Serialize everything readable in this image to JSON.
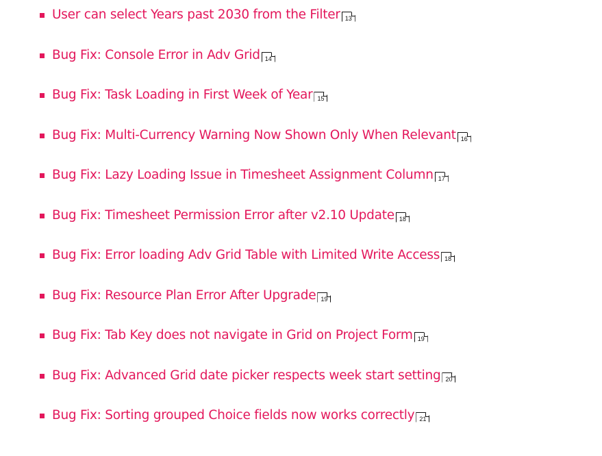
{
  "colors": {
    "link": "#e3175b",
    "bullet": "#e3175b",
    "page_ref": "#111111"
  },
  "bullet_icon": "square-bullet-icon",
  "page_ref_icon": "page-reference-icon",
  "toc": {
    "items": [
      {
        "label": "User can select Years past 2030 from the Filter",
        "page": "13"
      },
      {
        "label": "Bug Fix: Console Error in Adv Grid",
        "page": "14"
      },
      {
        "label": "Bug Fix: Task Loading in First Week of Year",
        "page": "15"
      },
      {
        "label": "Bug Fix: Multi-Currency Warning Now Shown Only When Relevant",
        "page": "16"
      },
      {
        "label": "Bug Fix: Lazy Loading Issue in Timesheet Assignment Column",
        "page": "17"
      },
      {
        "label": "Bug Fix: Timesheet Permission Error after v2.10 Update",
        "page": "18"
      },
      {
        "label": "Bug Fix: Error loading Adv Grid Table with Limited Write Access",
        "page": "18"
      },
      {
        "label": "Bug Fix: Resource Plan Error After Upgrade",
        "page": "19"
      },
      {
        "label": "Bug Fix: Tab Key does not navigate in Grid on Project Form",
        "page": "19"
      },
      {
        "label": "Bug Fix: Advanced Grid date picker respects week start setting",
        "page": "20"
      },
      {
        "label": "Bug Fix: Sorting grouped Choice fields now works correctly",
        "page": "21"
      }
    ]
  }
}
